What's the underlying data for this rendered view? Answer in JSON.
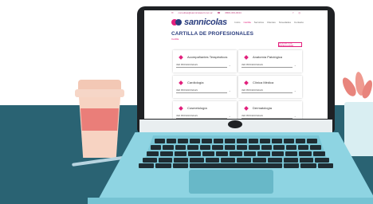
{
  "site": {
    "contact_email": "consultas@sannicolassrl.com.ar",
    "contact_phone": "0800-333-0044",
    "logo_text": "sannicolas",
    "nav": [
      "Inicio",
      "Cartilla",
      "Servicios",
      "Clientes",
      "Novedades",
      "Contacto"
    ],
    "page_title": "CARTILLA DE PROFESIONALES",
    "page_subtitle": "Cartilla",
    "filter_button": "BUSCAR POR ESPECIALIDAD"
  },
  "cards": [
    {
      "name": "Acompañantes Terapéuticos",
      "select": "VER PROFESIONALES"
    },
    {
      "name": "Anatomía Patológica",
      "select": "VER PROFESIONALES"
    },
    {
      "name": "Cardiología",
      "select": "VER PROFESIONALES"
    },
    {
      "name": "Clínica Médica",
      "select": "VER PROFESIONALES"
    },
    {
      "name": "Cosmetología",
      "select": "VER PROFESIONALES"
    },
    {
      "name": "Dermatología",
      "select": "VER PROFESIONALES"
    }
  ],
  "colors": {
    "brand_pink": "#e2207d",
    "brand_navy": "#2b3e7f",
    "desk": "#2a6373",
    "laptop_base": "#8ed4e2"
  }
}
